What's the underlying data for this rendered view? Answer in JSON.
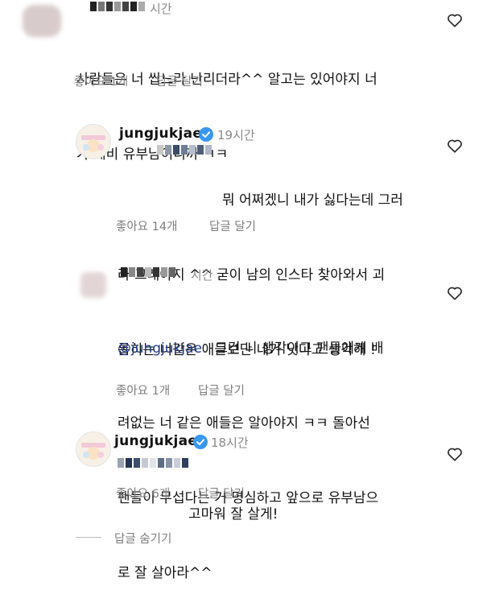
{
  "comments": [
    {
      "id": "c1",
      "time": "시간",
      "text_lines": [
        "사람들은 너 씹느라 난리더라^^ 알고는 있어야지 너",
        "가 예비 유부남이니까 ㅋㅋ"
      ],
      "likes": "좋아요 1개",
      "reply": "답글 달기"
    },
    {
      "id": "c2",
      "username": "jungjukjae",
      "time": "19시간",
      "text_lines": [
        "뭐 어쩌겠니 내가 싫다는데 그러",
        "라 그래야지 ^^ 굳이 남의 인스타 찾아와서 괴",
        "롭히는 너같은 애들보단 내가 낫다고 생각해 !"
      ],
      "likes": "좋아요 14개",
      "reply": "답글 달기"
    },
    {
      "id": "c3",
      "time": "시간",
      "mention": "@jungjukjae",
      "text_lines": [
        "그건 니 생각이고 팬들에게 배",
        "려없는 너 같은 애들은 알아야지 ㅋㅋ 돌아선",
        "팬들이 무섭다는 거 명심하고 앞으로 유부남으",
        "로 잘 살아라^^"
      ],
      "likes": "좋아요 1개",
      "reply": "답글 달기"
    },
    {
      "id": "c4",
      "username": "jungjukjae",
      "time": "18시간",
      "text_lines": [
        "고마워 잘 살게!"
      ],
      "likes": "좋아요 6개",
      "reply": "답글 달기"
    }
  ],
  "hide_replies": "답글 숨기기",
  "icons": {
    "heart": "heart-outline-icon",
    "verified": "verified-badge-icon"
  },
  "colors": {
    "verified": "#3897f0",
    "meta": "#7d7d7d",
    "mention": "#1f3a8a"
  }
}
